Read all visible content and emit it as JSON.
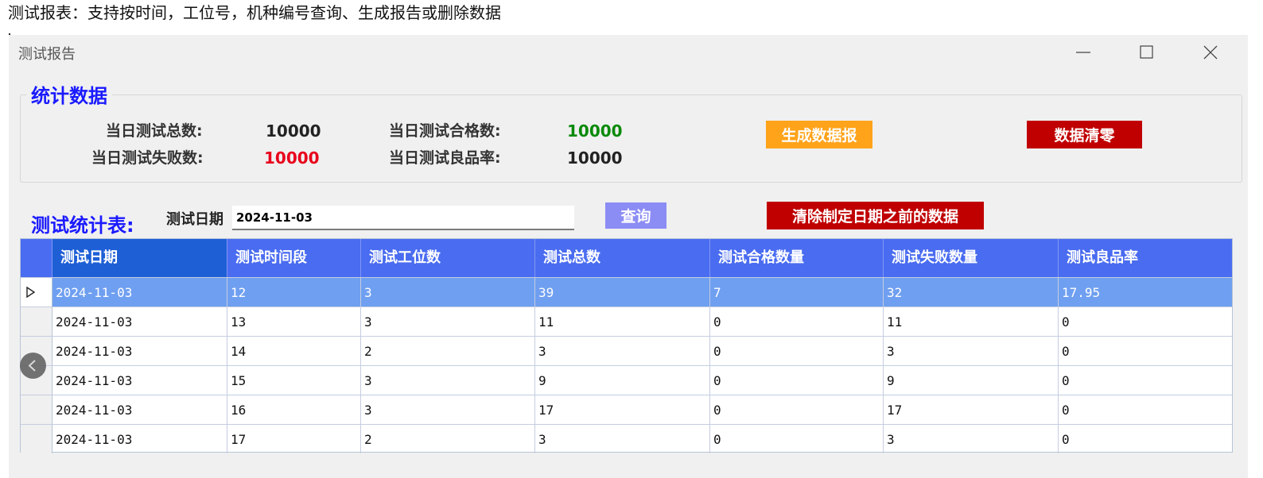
{
  "caption": "测试报表：支持按时间，工位号，机种编号查询、生成报告或删除数据",
  "window": {
    "title": "测试报告"
  },
  "stats": {
    "legend": "统计数据",
    "total_label": "当日测试总数:",
    "total_value": "10000",
    "pass_label": "当日测试合格数:",
    "pass_value": "10000",
    "fail_label": "当日测试失败数:",
    "fail_value": "10000",
    "yield_label": "当日测试良品率:",
    "yield_value": "10000",
    "generate_button": "生成数据报",
    "clear_button": "数据清零"
  },
  "query": {
    "heading": "测试统计表:",
    "date_label": "测试日期",
    "date_value": "2024-11-03",
    "query_button": "查询",
    "delete_button": "清除制定日期之前的数据"
  },
  "table": {
    "columns": [
      "测试日期",
      "测试时间段",
      "测试工位数",
      "测试总数",
      "测试合格数量",
      "测试失败数量",
      "测试良品率"
    ],
    "rows": [
      [
        "2024-11-03",
        "12",
        "3",
        "39",
        "7",
        "32",
        "17.95"
      ],
      [
        "2024-11-03",
        "13",
        "3",
        "11",
        "0",
        "11",
        "0"
      ],
      [
        "2024-11-03",
        "14",
        "2",
        "3",
        "0",
        "3",
        "0"
      ],
      [
        "2024-11-03",
        "15",
        "3",
        "9",
        "0",
        "9",
        "0"
      ],
      [
        "2024-11-03",
        "16",
        "3",
        "17",
        "0",
        "17",
        "0"
      ],
      [
        "2024-11-03",
        "17",
        "2",
        "3",
        "0",
        "3",
        "0"
      ]
    ],
    "selected_row": 0
  },
  "colors": {
    "accent_blue": "#1a1aff",
    "header_blue": "#4a6cf0",
    "selected_row": "#6f9ff0",
    "fail_red": "#e8001c",
    "pass_green": "#0a8a0a",
    "orange_button": "#ffa31a",
    "red_button": "#c00000"
  }
}
